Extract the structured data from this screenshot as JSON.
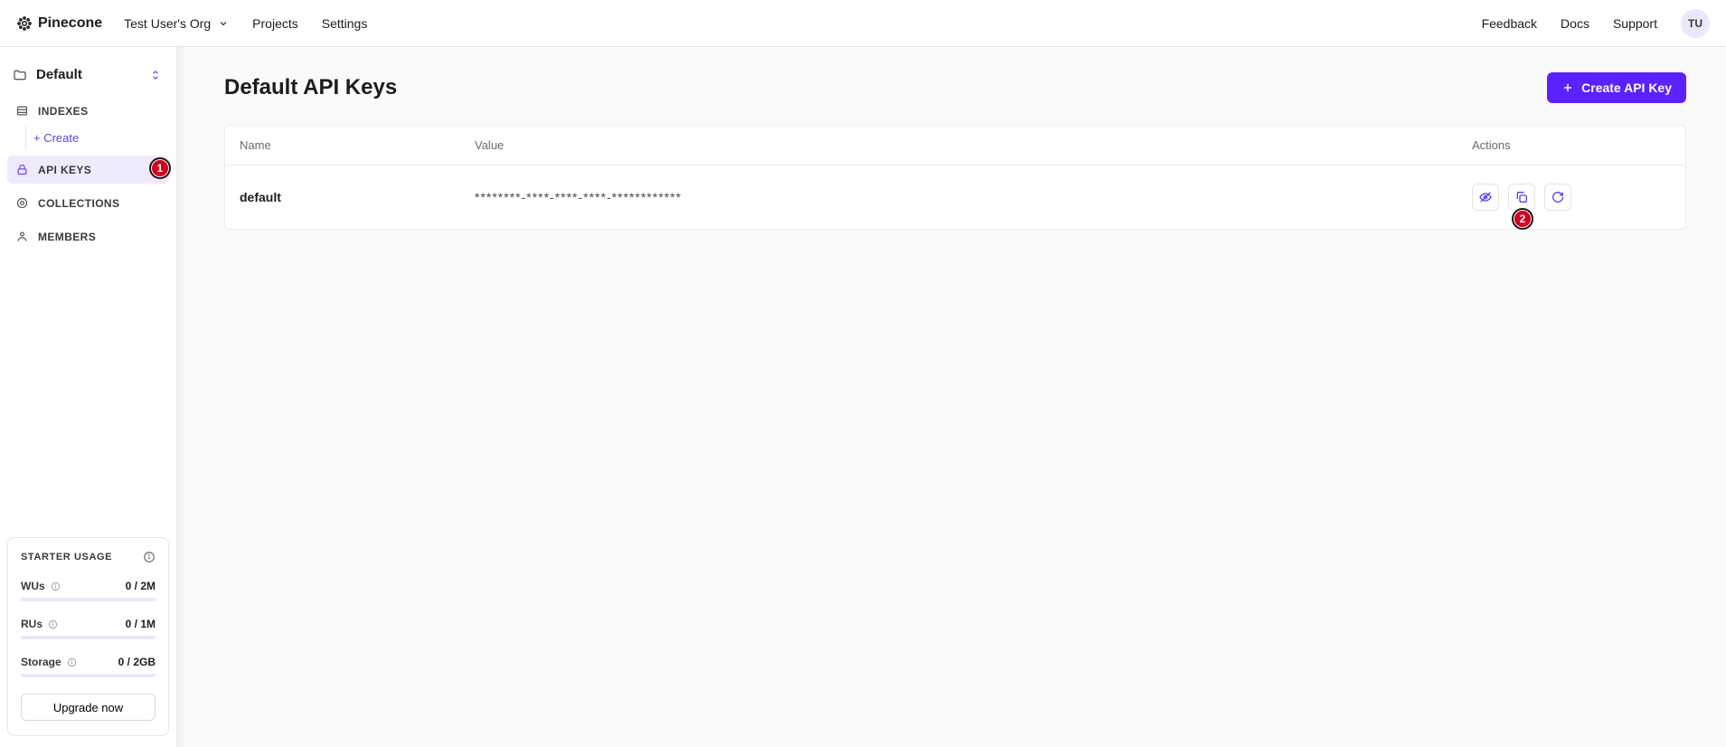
{
  "brand": "Pinecone",
  "topnav": {
    "org": "Test User's Org",
    "items": [
      "Projects",
      "Settings"
    ],
    "right": [
      "Feedback",
      "Docs",
      "Support"
    ],
    "avatar": "TU"
  },
  "sidebar": {
    "project": "Default",
    "items": [
      {
        "key": "indexes",
        "label": "INDEXES"
      },
      {
        "key": "api-keys",
        "label": "API KEYS"
      },
      {
        "key": "collections",
        "label": "COLLECTIONS"
      },
      {
        "key": "members",
        "label": "MEMBERS"
      }
    ],
    "create_label": "+ Create",
    "usage": {
      "title": "STARTER USAGE",
      "rows": [
        {
          "label": "WUs",
          "value": "0 / 2M"
        },
        {
          "label": "RUs",
          "value": "0 / 1M"
        },
        {
          "label": "Storage",
          "value": "0 / 2GB"
        }
      ],
      "upgrade": "Upgrade now"
    }
  },
  "page": {
    "title": "Default API Keys",
    "create_button": "Create API Key",
    "columns": {
      "name": "Name",
      "value": "Value",
      "actions": "Actions"
    },
    "rows": [
      {
        "name": "default",
        "value": "********-****-****-****-************"
      }
    ]
  },
  "annotations": {
    "one": "1",
    "two": "2"
  }
}
